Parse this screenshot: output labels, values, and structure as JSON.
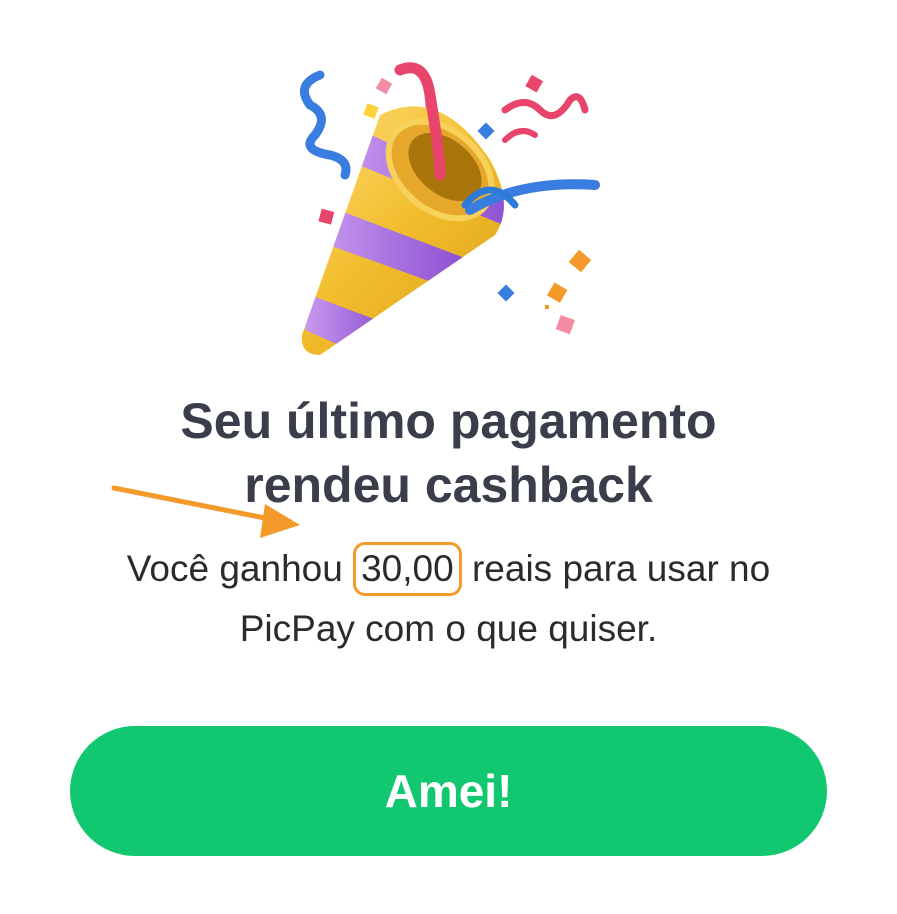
{
  "illustration": {
    "icon": "party-popper-icon"
  },
  "title": {
    "line1": "Seu último pagamento",
    "line2": "rendeu cashback"
  },
  "message": {
    "before_amount": "Você ganhou ",
    "amount": "30,00",
    "after_amount": " reais para usar no",
    "line2": "PicPay com o que quiser."
  },
  "cta": {
    "label": "Amei!"
  },
  "colors": {
    "accent_green": "#11c76f",
    "highlight_orange": "#f39a2b",
    "title_text": "#3a3d4a"
  }
}
